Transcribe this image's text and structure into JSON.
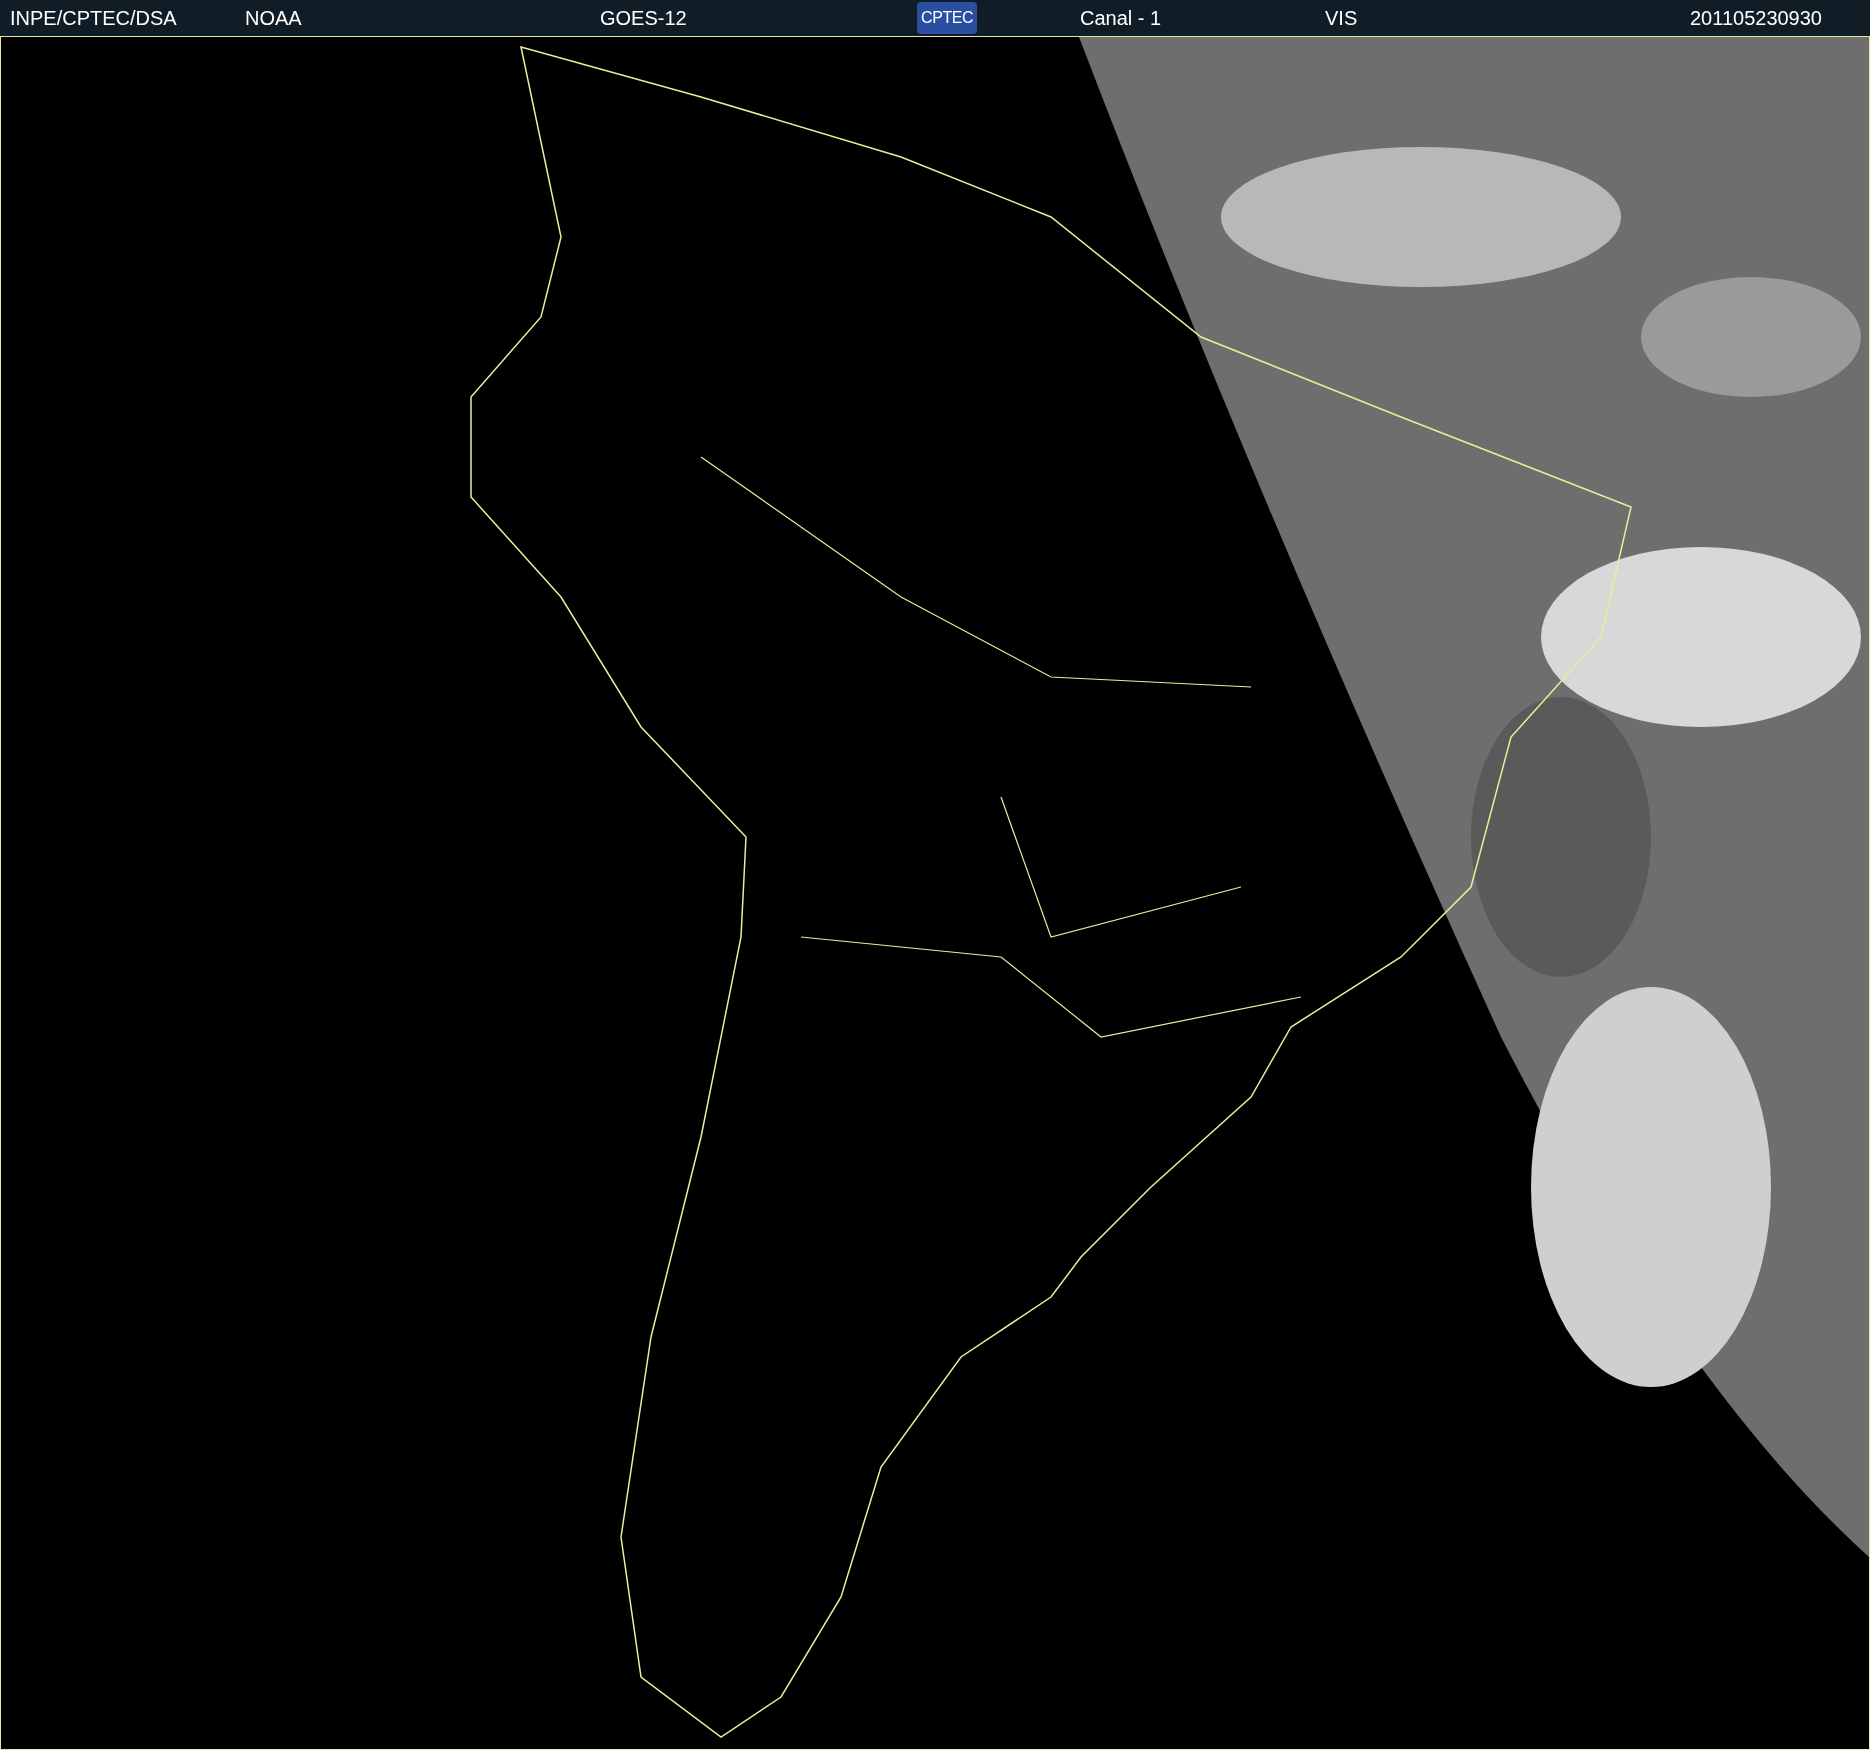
{
  "header": {
    "items": [
      {
        "kind": "text",
        "text": "INPE/CPTEC/DSA"
      },
      {
        "kind": "text",
        "text": "NOAA"
      },
      {
        "kind": "text",
        "text": "GOES-12"
      },
      {
        "kind": "logo",
        "text": "CPTEC"
      },
      {
        "kind": "text",
        "text": "Canal - 1"
      },
      {
        "kind": "text",
        "text": "VIS"
      },
      {
        "kind": "text",
        "text": "201105230930"
      }
    ]
  }
}
